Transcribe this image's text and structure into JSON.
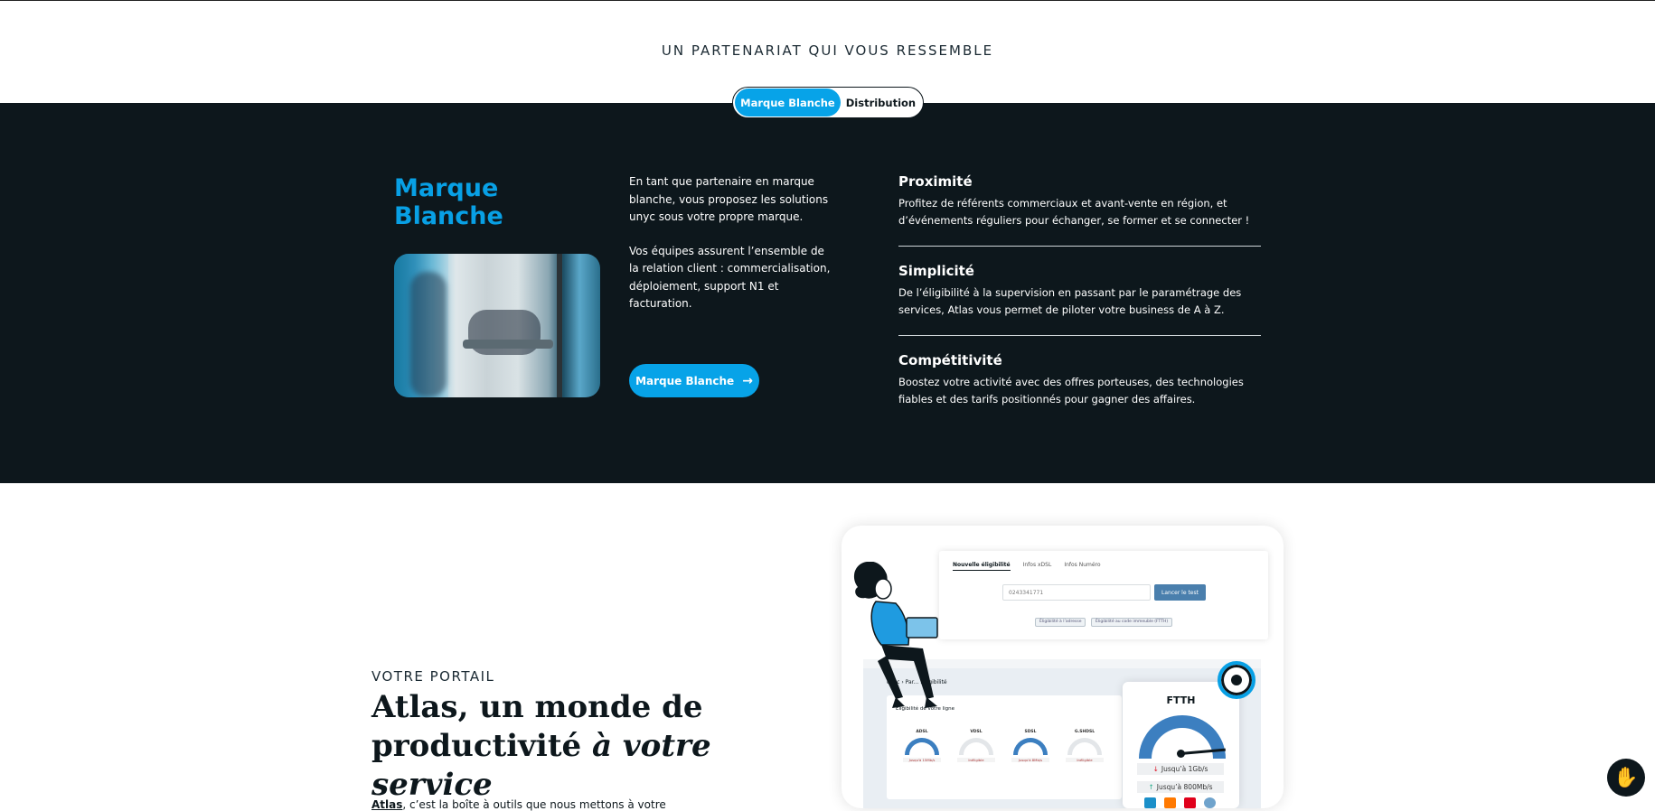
{
  "partnership": {
    "title": "UN PARTENARIAT QUI VOUS RESSEMBLE",
    "toggle": {
      "active": "Marque Blanche",
      "inactive": "Distribution"
    }
  },
  "brand": {
    "title_line1": "Marque",
    "title_line2": "Blanche",
    "intro_p1": "En tant que partenaire en marque blanche, vous proposez les solutions unyc sous votre propre marque.",
    "intro_p2": "Vos équipes assurent l’ensemble de la relation client : commercialisation, déploiement, support N1 et facturation.",
    "cta_label": "Marque Blanche",
    "cta_icon": "arrow-right-icon"
  },
  "features": [
    {
      "title": "Proximité",
      "text": "Profitez de référents commerciaux et avant-vente  en région, et d’événements réguliers pour échanger, se former et se connecter !"
    },
    {
      "title": "Simplicité",
      "text": "De l’éligibilité à la supervision en passant par le paramétrage des services, Atlas vous permet de piloter votre business de A à Z."
    },
    {
      "title": "Compétitivité",
      "text": "Boostez votre activité avec des offres porteuses, des technologies fiables et des tarifs positionnés pour gagner des affaires."
    }
  ],
  "portal": {
    "kicker": "VOTRE PORTAIL",
    "title_plain": "Atlas, un monde de productivité",
    "title_italic": "à votre service",
    "body_bold": "Atlas",
    "body_rest": ", c’est la boîte à outils que nous mettons à votre"
  },
  "mockup": {
    "tabs": [
      "Nouvelle éligibilité",
      "Infos xDSL",
      "Infos Numéro"
    ],
    "input_value": "0243341771",
    "test_button": "Lancer le test",
    "chip1": "Éligibilité à l’adresse",
    "chip2": "Éligibilité au code immeuble (FTTH)",
    "crumb": "unyc › Par... ...ligibilité",
    "card_title": "Éligibilité de votre ligne",
    "gauges": [
      {
        "name": "ADSL",
        "lbl": "Jusqu'à 15Mb/s"
      },
      {
        "name": "VDSL",
        "lbl": "Inéligible"
      },
      {
        "name": "SDSL",
        "lbl": "Jusqu'à 8Mb/s"
      },
      {
        "name": "G.SHDSL",
        "lbl": "Inéligible"
      }
    ],
    "ftth_title": "FTTH",
    "ftth_down": "Jusqu’à 1Gb/s",
    "ftth_up": "Jusqu’à 800Mb/s"
  },
  "colors": {
    "accent": "#07a3e8",
    "dark": "#0d171c",
    "gauge": "#3c7fc0"
  }
}
